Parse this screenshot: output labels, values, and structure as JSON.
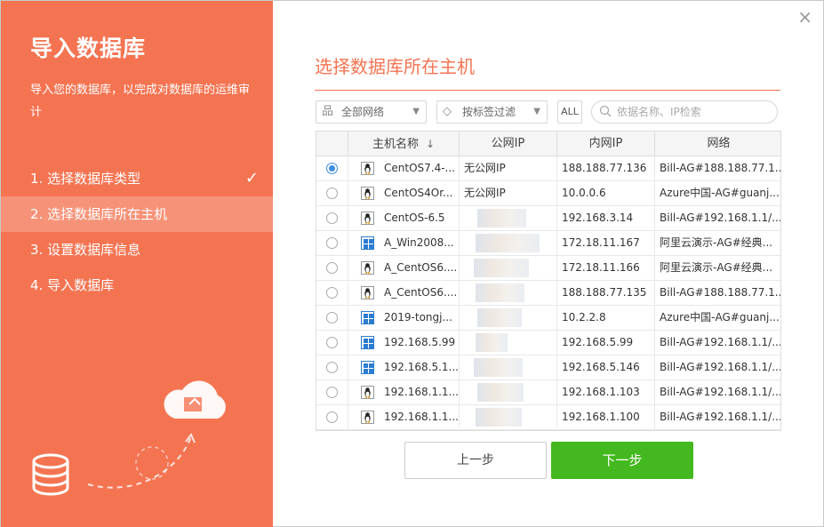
{
  "window": {
    "close_label": "×"
  },
  "sidebar": {
    "title": "导入数据库",
    "description": "导入您的数据库，以完成对数据库的运维审计",
    "steps": [
      {
        "label": "1. 选择数据库类型",
        "done": true,
        "check": "✓"
      },
      {
        "label": "2. 选择数据库所在主机",
        "active": true
      },
      {
        "label": "3. 设置数据库信息"
      },
      {
        "label": "4. 导入数据库"
      }
    ],
    "icons": [
      "cloud-upload-icon",
      "database-icon"
    ]
  },
  "main": {
    "title": "选择数据库所在主机",
    "filters": {
      "network": "全部网络",
      "tag": "按标签过滤",
      "all_button": "ALL",
      "search_placeholder": "依据名称、IP检索"
    },
    "table": {
      "columns": [
        "",
        "主机名称",
        "公网IP",
        "内网IP",
        "网络"
      ],
      "sort_indicator": "↓",
      "rows": [
        {
          "selected": true,
          "os": "linux",
          "name": "CentOS7.4-...",
          "public_ip": "无公网IP",
          "private_ip": "188.188.77.136",
          "network": "Bill-AG#188.188.77.1..."
        },
        {
          "selected": false,
          "os": "linux",
          "name": "CentOS4Or...",
          "public_ip": "无公网IP",
          "private_ip": "10.0.0.6",
          "network": "Azure中国-AG#guanj..."
        },
        {
          "selected": false,
          "os": "linux",
          "name": "CentOS-6.5",
          "public_ip": "",
          "private_ip": "192.168.3.14",
          "network": "Bill-AG#192.168.1.1/..."
        },
        {
          "selected": false,
          "os": "windows",
          "name": "A_Win2008...",
          "public_ip": "",
          "private_ip": "172.18.11.167",
          "network": "阿里云演示-AG#经典..."
        },
        {
          "selected": false,
          "os": "linux",
          "name": "A_CentOS6....",
          "public_ip": "",
          "private_ip": "172.18.11.166",
          "network": "阿里云演示-AG#经典..."
        },
        {
          "selected": false,
          "os": "linux",
          "name": "A_CentOS6....",
          "public_ip": "",
          "private_ip": "188.188.77.135",
          "network": "Bill-AG#188.188.77.1..."
        },
        {
          "selected": false,
          "os": "windows",
          "name": "2019-tongj...",
          "public_ip": "",
          "private_ip": "10.2.2.8",
          "network": "Azure中国-AG#guanj..."
        },
        {
          "selected": false,
          "os": "windows",
          "name": "192.168.5.99",
          "public_ip": "",
          "private_ip": "192.168.5.99",
          "network": "Bill-AG#192.168.1.1/..."
        },
        {
          "selected": false,
          "os": "windows",
          "name": "192.168.5.1...",
          "public_ip": "",
          "private_ip": "192.168.5.146",
          "network": "Bill-AG#192.168.1.1/..."
        },
        {
          "selected": false,
          "os": "linux",
          "name": "192.168.1.1...",
          "public_ip": "",
          "private_ip": "192.168.1.103",
          "network": "Bill-AG#192.168.1.1/..."
        },
        {
          "selected": false,
          "os": "linux",
          "name": "192.168.1.1...",
          "public_ip": "",
          "private_ip": "192.168.1.100",
          "network": "Bill-AG#192.168.1.1/..."
        }
      ]
    },
    "buttons": {
      "prev": "上一步",
      "next": "下一步"
    }
  },
  "colors": {
    "accent": "#f47452",
    "primary_button": "#44b81f",
    "radio_selected": "#3b8de0"
  }
}
